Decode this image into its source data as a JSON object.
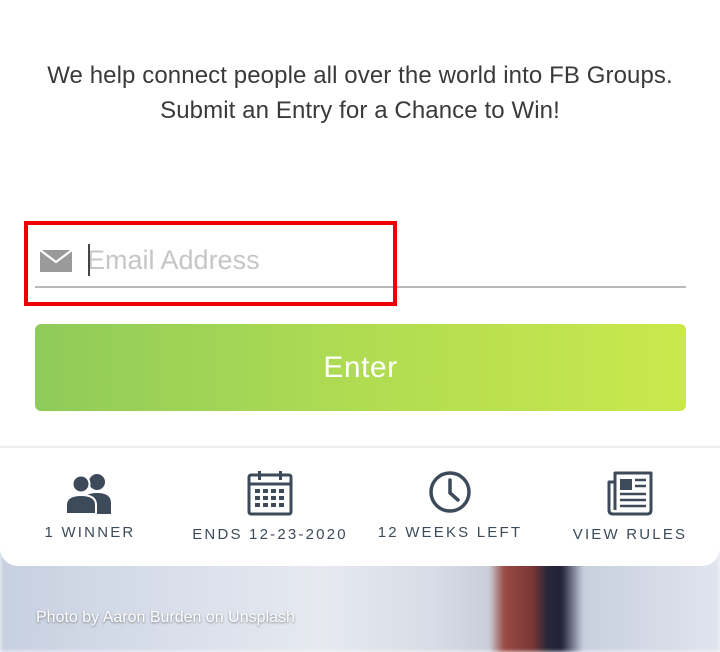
{
  "tagline": {
    "line1": "We help connect people all over the world into FB Groups.",
    "line2": "Submit an Entry for a Chance to Win!"
  },
  "email": {
    "placeholder": "Email Address",
    "icon": "mail-icon"
  },
  "enter_button": {
    "label": "Enter"
  },
  "stats": [
    {
      "icon": "users-icon",
      "label": "1 WINNER"
    },
    {
      "icon": "calendar-icon",
      "label": "ENDS 12-23-2020"
    },
    {
      "icon": "clock-icon",
      "label": "12 WEEKS LEFT"
    },
    {
      "icon": "newspaper-icon",
      "label": "VIEW RULES"
    }
  ],
  "photo_credit": "Photo by Aaron Burden on Unsplash",
  "colors": {
    "highlight": "#ee0000",
    "button_gradient_start": "#8fcb5a",
    "button_gradient_end": "#cae84c",
    "icon": "#3c4a5a"
  }
}
